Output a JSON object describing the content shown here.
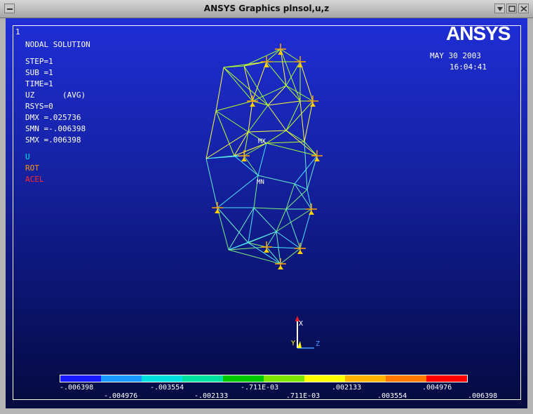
{
  "window": {
    "title": "ANSYS Graphics    plnsol,u,z"
  },
  "plot": {
    "window_number": "1",
    "logo": "ANSYS",
    "date": "MAY 30 2003",
    "time": "16:04:41",
    "info_lines": [
      "NODAL SOLUTION",
      "",
      "STEP=1",
      "SUB =1",
      "TIME=1",
      "UZ      (AVG)",
      "RSYS=0",
      "DMX =.025736",
      "SMN =-.006398",
      "SMX =.006398"
    ],
    "symbol_legend": [
      {
        "label": "U",
        "color": "#00e5e5"
      },
      {
        "label": "ROT",
        "color": "#ff9a00"
      },
      {
        "label": "ACEL",
        "color": "#ff2a2a"
      }
    ],
    "markers": {
      "max": "MX",
      "min": "MN"
    },
    "triad": {
      "x": "X",
      "y": "Y",
      "z": "Z"
    },
    "contour_colors": [
      "#1a1aff",
      "#1a9aff",
      "#00e0e0",
      "#00e0a0",
      "#00c800",
      "#7ee600",
      "#ffff00",
      "#ffb400",
      "#ff7800",
      "#ff0000"
    ],
    "contour_labels_top": [
      "-.006398",
      "-.003554",
      "-.711E-03",
      ".002133",
      ".004976"
    ],
    "contour_labels_bottom": [
      "-.004976",
      "-.002133",
      ".711E-03",
      ".003554",
      ".006398"
    ]
  }
}
